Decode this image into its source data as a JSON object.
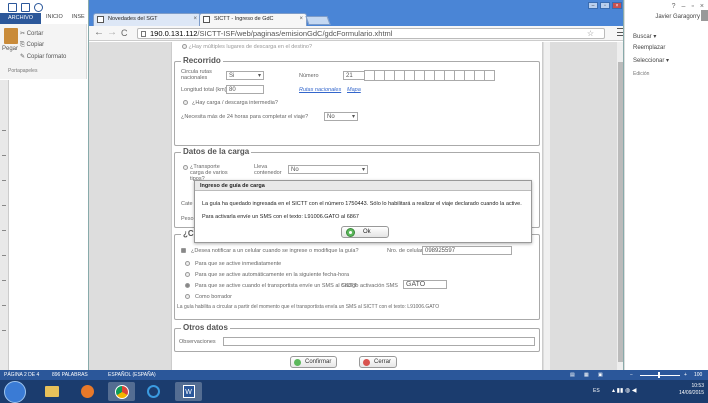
{
  "word": {
    "file_tab": "ARCHIVO",
    "tabs": [
      "INICIO",
      "INSE"
    ],
    "ribbon": {
      "cut": "Cortar",
      "copy": "Copiar",
      "paste": "Pegar",
      "format_painter": "Copiar formato",
      "group": "Portapapeles"
    },
    "user_name": "Javier Garagorry",
    "right_pane": [
      "Buscar",
      "Reemplazar",
      "Seleccionar",
      "Edición"
    ],
    "window_controls": [
      "?",
      "–",
      "▫",
      "×"
    ],
    "status": {
      "page": "PÁGINA 2 DE 4",
      "words": "896 PALABRAS",
      "language": "ESPAÑOL (ESPAÑA)",
      "zoom": "100"
    }
  },
  "taskbar": {
    "apps": [
      "start",
      "file-explorer",
      "media",
      "chrome",
      "ie",
      "word"
    ],
    "lang": "ES",
    "time": "10:53",
    "date": "14/09/2015"
  },
  "browser": {
    "tabs": [
      {
        "label": "Novedades del SGT"
      },
      {
        "label": "SICTT - Ingreso de GdC"
      }
    ],
    "url_host": "190.0.131.112",
    "url_path": "/SICTT-ISF/web/paginas/emisionGdC/gdcFormulario.xhtml"
  },
  "form": {
    "top_question": "¿Hay múltiples lugares de descarga en el destino?",
    "recorrido": {
      "title": "Recorrido",
      "circ_rutas_label": "Circula rutas nacionales",
      "circ_rutas_value": "Si",
      "numero_label": "Número",
      "numero_value": "21",
      "longitud_label": "Longitud total (km)",
      "longitud_value": "80",
      "rutas_link": "Rutas nacionales",
      "mapa_link": "Mapa",
      "carga_intermedia": "¿Hay carga / descarga intermedia?",
      "mas_24h_label": "¿Necesita más de 24 horas para completar el viaje?",
      "mas_24h_value": "No"
    },
    "datos_carga": {
      "title": "Datos de la carga",
      "transporte_label": "¿Transporte carga de varios tipos?",
      "lleva_contenedor_label": "Lleva contenedor",
      "lleva_contenedor_value": "No",
      "cate_label": "Cate",
      "peso_label": "Peso"
    },
    "sms": {
      "title_partial": "¿Co",
      "celular_question": "¿Desea notificar a un celular cuando se ingrese o modifique la guía?",
      "nro_celular_label": "Nro. de celular",
      "nro_celular_value": "098925597",
      "opt1": "Para que se active inmediatamente",
      "opt2": "Para que se active automáticamente en la siguiente fecha-hora",
      "opt3": "Para que se active cuando el transportista envíe un SMS al SICTT",
      "codigo_label": "Código activación SMS",
      "codigo_value": "GATO",
      "opt4": "Como borrador",
      "footer": "La guía habilita a circular a partir del momento que el transportista envía un SMS al SICTT con el texto: L91006.GATO"
    },
    "otros": {
      "title": "Otros datos",
      "observaciones_label": "Observaciones"
    },
    "confirmar": "Confirmar",
    "cerrar": "Cerrar"
  },
  "modal": {
    "title": "Ingreso de guía de carga",
    "message1": "La guía ha quedado ingresada en el SICTT con el número 1750443. Sólo lo habilitará a realizar el viaje declarado cuando la active.",
    "message2": "Para activarla envíe un SMS con el texto: L91006.GATO al 6867",
    "ok": "Ok"
  }
}
